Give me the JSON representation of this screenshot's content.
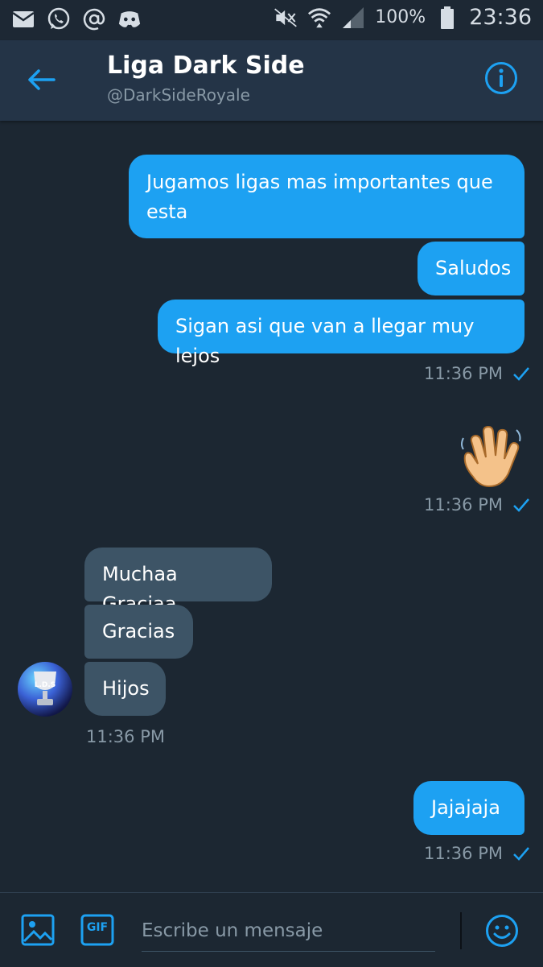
{
  "status_bar": {
    "battery_text": "100%",
    "clock": "23:36",
    "icons": [
      "mail-icon",
      "whatsapp-icon",
      "at-icon",
      "discord-icon",
      "mute-icon",
      "wifi-icon",
      "signal-icon",
      "battery-icon"
    ]
  },
  "header": {
    "title": "Liga Dark Side",
    "handle": "@DarkSideRoyale",
    "back_icon": "back-arrow-icon",
    "info_icon": "info-icon"
  },
  "messages": [
    {
      "direction": "out",
      "text_lines": [
        "Jugamos ligas mas importantes que",
        "esta"
      ]
    },
    {
      "direction": "out",
      "text": "Saludos"
    },
    {
      "direction": "out",
      "text": "Sigan asi que van a llegar muy lejos",
      "timestamp": "11:36 PM",
      "read": true
    },
    {
      "direction": "out",
      "emoji": "waving-hand",
      "timestamp": "11:36 PM",
      "read": true
    },
    {
      "direction": "in",
      "text": "Muchaa Graciaa"
    },
    {
      "direction": "in",
      "text": "Gracias"
    },
    {
      "direction": "in",
      "text": "Hijos",
      "timestamp": "11:36 PM",
      "avatar_text": "L.D.S"
    },
    {
      "direction": "out",
      "text": "Jajajaja",
      "timestamp": "11:36 PM",
      "read": true
    }
  ],
  "composer": {
    "placeholder": "Escribe un mensaje",
    "gif_label": "GIF",
    "media_icon": "image-icon",
    "emoji_icon": "smiley-icon"
  },
  "colors": {
    "background": "#1c2732",
    "header": "#243447",
    "accent": "#1da1f2",
    "incoming_bubble": "#3d5466",
    "muted_text": "#8899a6"
  }
}
